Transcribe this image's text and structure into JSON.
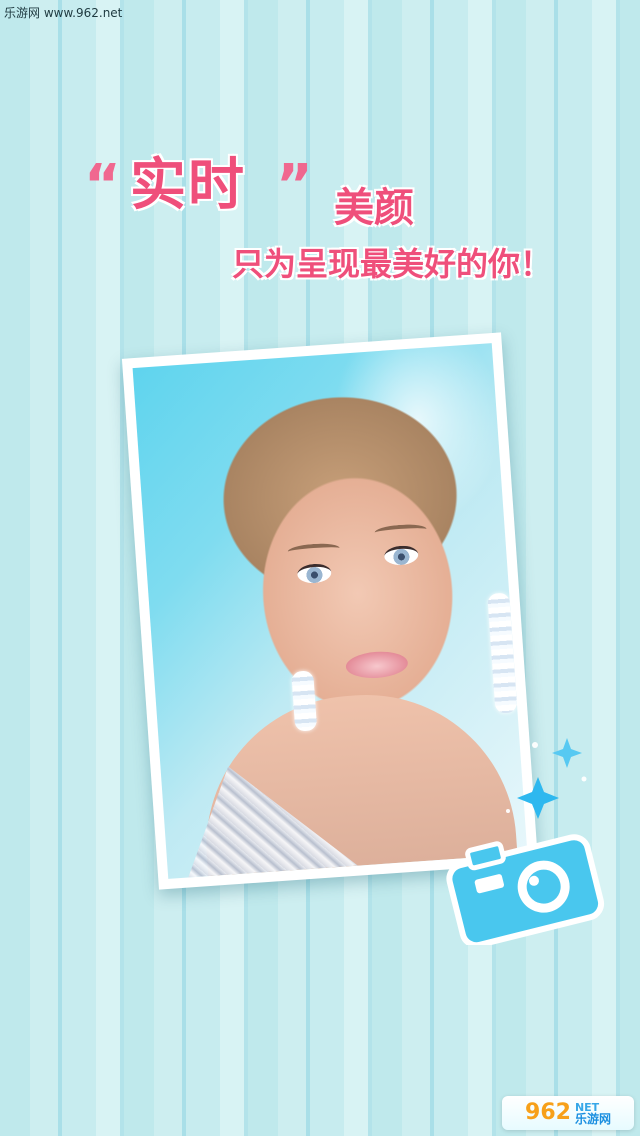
{
  "watermark_top": {
    "text": "乐游网 www.962.net"
  },
  "hero": {
    "quote_open": "“",
    "title_highlight": "实时",
    "quote_close": "”",
    "title_suffix": "美颜",
    "subtitle": "只为呈现最美好的你！"
  },
  "illustrations": {
    "photo": "portrait-photo",
    "camera": "camera-icon",
    "sparkles": "sparkle-icons"
  },
  "watermark_bottom": {
    "number": "962",
    "net": "NET",
    "name": "乐游网"
  },
  "colors": {
    "headline_pink": "#ef4f7b",
    "background_teal": "#bfe9ec",
    "camera_blue": "#49c7ee"
  }
}
